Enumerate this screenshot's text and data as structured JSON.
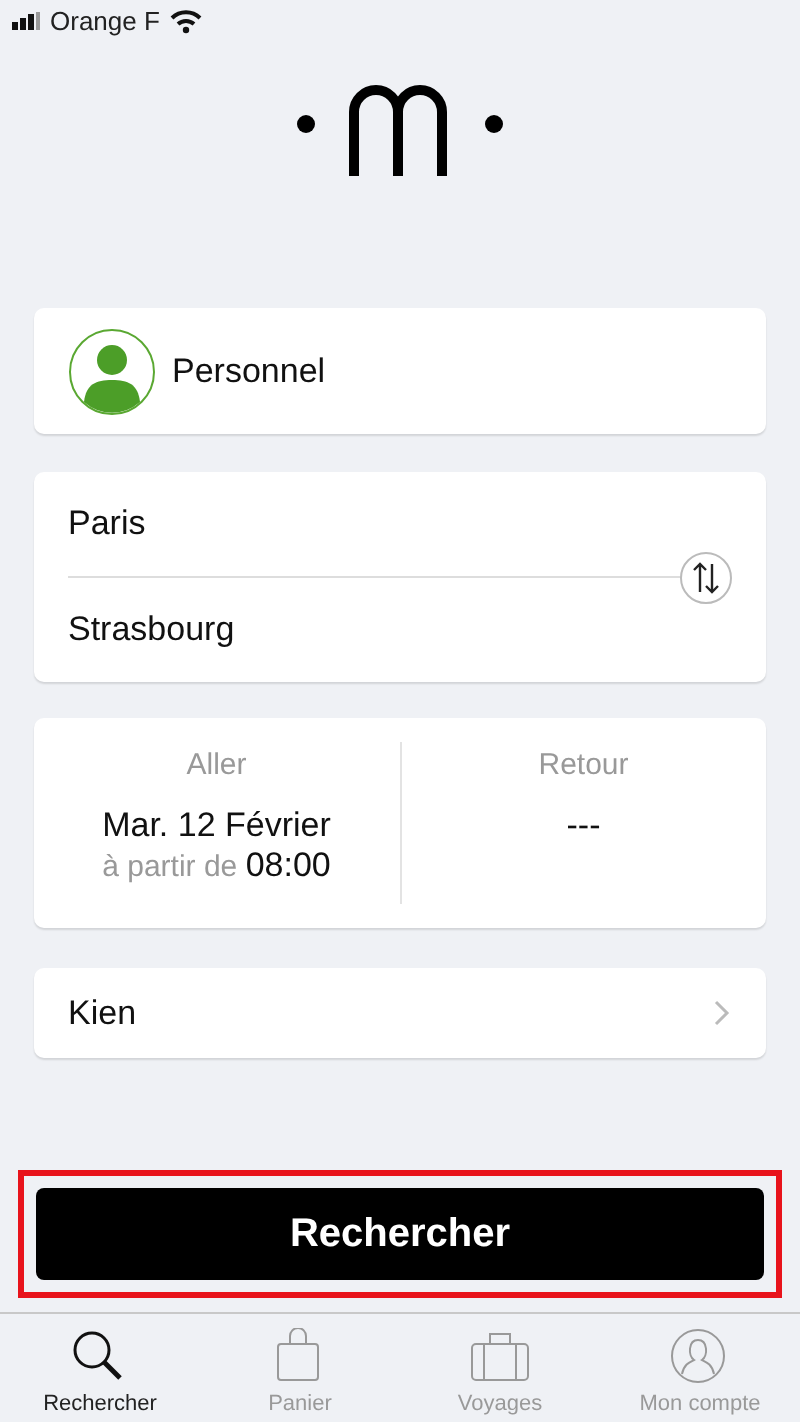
{
  "status_bar": {
    "carrier": "Orange F"
  },
  "profile": {
    "label": "Personnel"
  },
  "route": {
    "origin": "Paris",
    "destination": "Strasbourg"
  },
  "dates": {
    "outbound": {
      "label": "Aller",
      "date": "Mar. 12 Février",
      "prefix": "à partir de",
      "time": "08:00"
    },
    "return": {
      "label": "Retour",
      "date": "---"
    }
  },
  "passenger": {
    "name": "Kien"
  },
  "search_button": {
    "label": "Rechercher",
    "highlighted": true
  },
  "tabs": [
    {
      "label": "Rechercher",
      "kind": "search",
      "selected": true
    },
    {
      "label": "Panier",
      "kind": "bag",
      "selected": false
    },
    {
      "label": "Voyages",
      "kind": "suitcase",
      "selected": false
    },
    {
      "label": "Mon compte",
      "kind": "account",
      "selected": false
    }
  ]
}
